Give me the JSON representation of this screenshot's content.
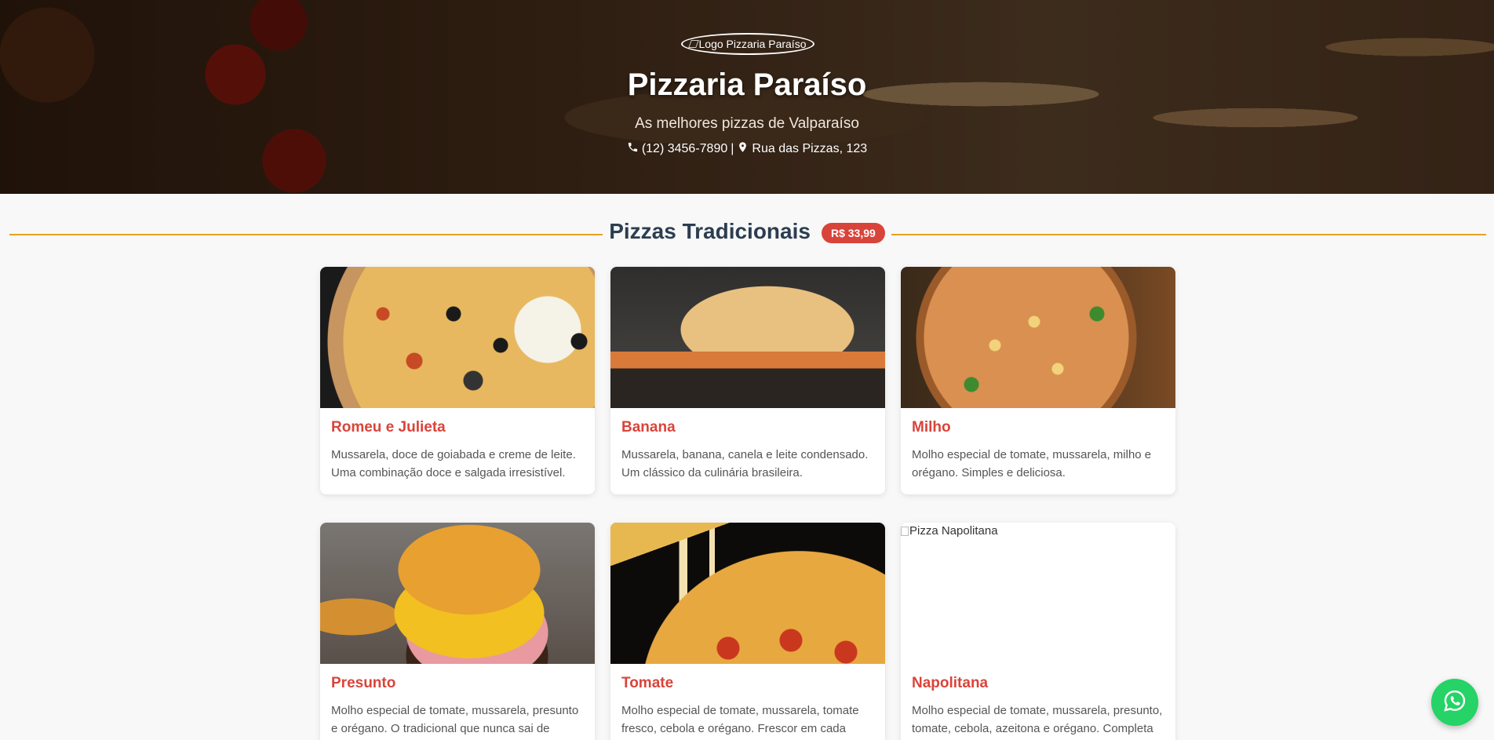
{
  "header": {
    "logo_alt": "Logo Pizzaria Paraíso",
    "title": "Pizzaria Paraíso",
    "subtitle": "As melhores pizzas de Valparaíso",
    "phone": "(12) 3456-7890",
    "separator": "|",
    "address": "Rua das Pizzas, 123"
  },
  "section": {
    "title": "Pizzas Tradicionais",
    "price": "R$ 33,99",
    "accent_color": "#e8a020"
  },
  "pizzas": [
    {
      "name": "Romeu e Julieta",
      "description": "Mussarela, doce de goiabada e creme de leite. Uma combinação doce e salgada irresistível."
    },
    {
      "name": "Banana",
      "description": "Mussarela, banana, canela e leite condensado. Um clássico da culinária brasileira."
    },
    {
      "name": "Milho",
      "description": "Molho especial de tomate, mussarela, milho e orégano. Simples e deliciosa."
    },
    {
      "name": "Presunto",
      "description": "Molho especial de tomate, mussarela, presunto e orégano. O tradicional que nunca sai de"
    },
    {
      "name": "Tomate",
      "description": "Molho especial de tomate, mussarela, tomate fresco, cebola e orégano. Frescor em cada"
    },
    {
      "name": "Napolitana",
      "description": "Molho especial de tomate, mussarela, presunto, tomate, cebola, azeitona e orégano. Completa",
      "image_alt": "Pizza Napolitana"
    }
  ],
  "colors": {
    "brand_red": "#d9443a",
    "whatsapp_green": "#25d366"
  },
  "icons": [
    "phone-icon",
    "map-marker-icon",
    "whatsapp-icon"
  ]
}
